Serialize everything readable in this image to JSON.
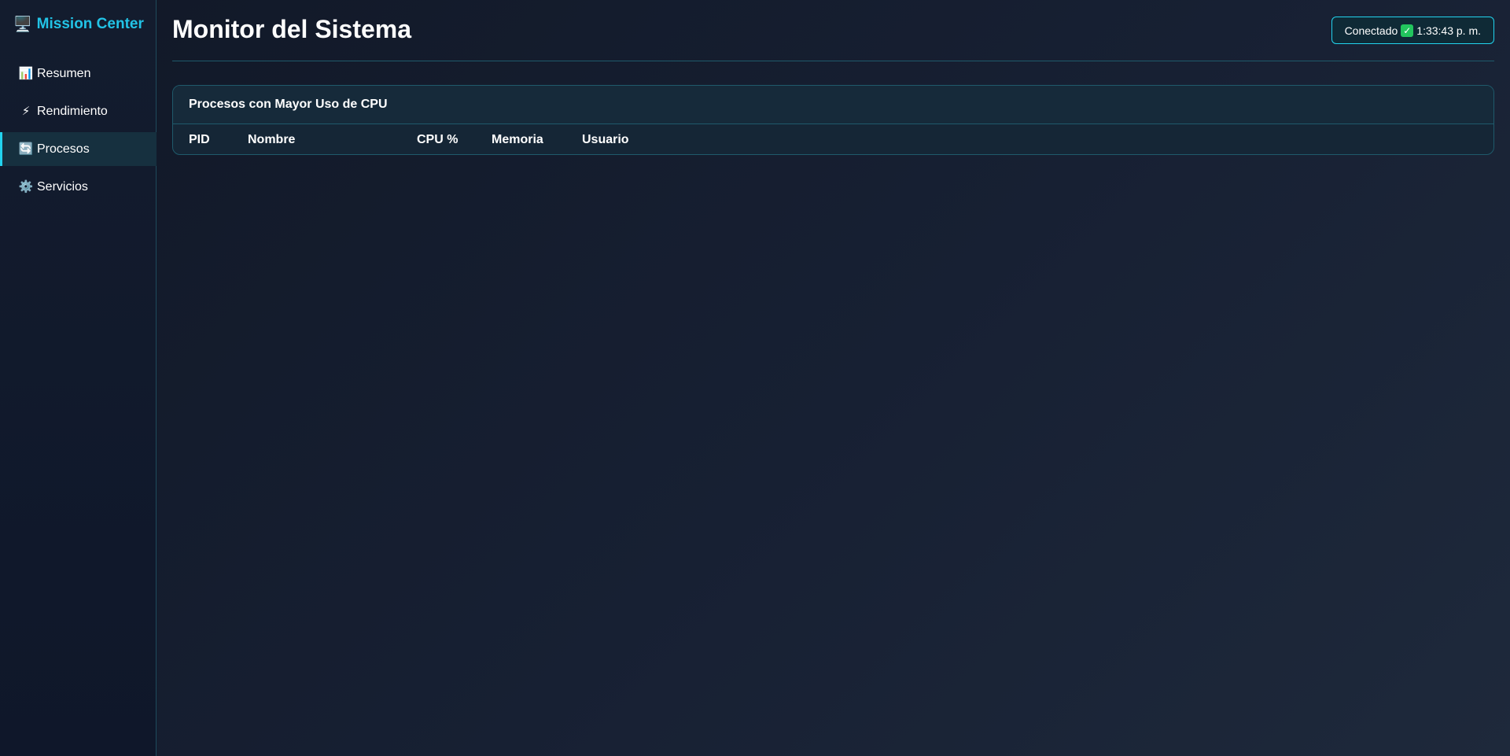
{
  "sidebar": {
    "brand": {
      "icon": "🖥️",
      "icon_name": "monitor-icon",
      "label": "Mission Center"
    },
    "items": [
      {
        "icon": "📊",
        "icon_name": "bar-chart-icon",
        "label": "Resumen",
        "active": false
      },
      {
        "icon": "⚡",
        "icon_name": "lightning-icon",
        "label": "Rendimiento",
        "active": false
      },
      {
        "icon": "🔄",
        "icon_name": "refresh-icon",
        "label": "Procesos",
        "active": true
      },
      {
        "icon": "⚙️",
        "icon_name": "gear-icon",
        "label": "Servicios",
        "active": false
      }
    ]
  },
  "header": {
    "title": "Monitor del Sistema",
    "status": {
      "label": "Conectado",
      "check": "✓",
      "time": "1:33:43 p. m."
    }
  },
  "panel": {
    "title": "Procesos con Mayor Uso de CPU",
    "columns": [
      "PID",
      "Nombre",
      "CPU %",
      "Memoria",
      "Usuario"
    ],
    "rows": []
  },
  "colors": {
    "accent": "#22d3ee",
    "brand": "#22c3e6",
    "check": "#22c55e",
    "background": "#111827"
  }
}
